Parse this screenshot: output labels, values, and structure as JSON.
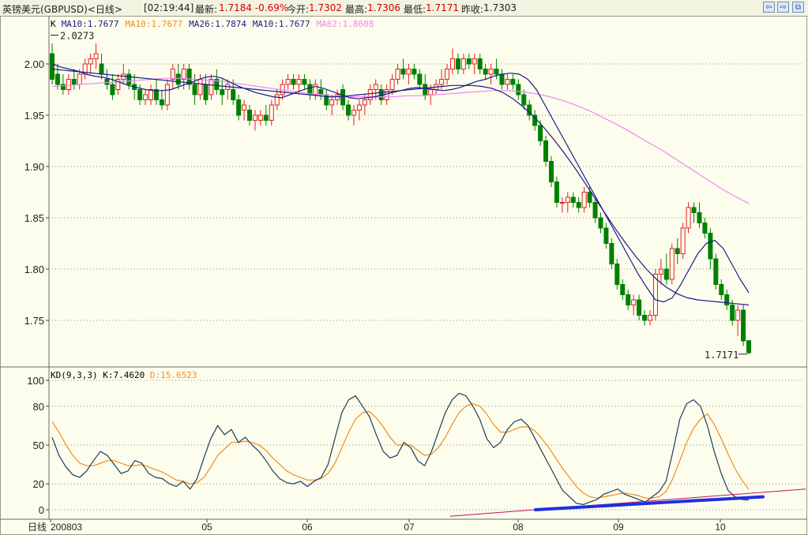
{
  "header": {
    "instrument": "英镑美元(GBPUSD)<日线>",
    "time": "[02:19:44]",
    "latest_label": "最新:",
    "latest": "1.7184 -0.69%",
    "open_label": "今开:",
    "open": "1.7302",
    "high_label": "最高:",
    "high": "1.7306",
    "low_label": "最低:",
    "low": "1.7171",
    "prev_close_label": "昨收:",
    "prev_close": "1.7303"
  },
  "colors": {
    "background": "#fdfded",
    "up_candle": "#e02020",
    "down_candle": "#008000",
    "ma10": "#1a1a8c",
    "ma26": "#1a1a8c",
    "ma62": "#ee88ee",
    "k_line": "#1c3d5c",
    "d_line": "#ef8c1c",
    "trend_line": "#1f2fe0",
    "trend_extension": "#c01060",
    "grid": "#8a8a8a"
  },
  "chart_data": [
    {
      "type": "candlestick",
      "legend": [
        {
          "text": "K",
          "color": "#000000"
        },
        {
          "text": "MA10:1.7677",
          "color": "#1a1a8c"
        },
        {
          "text": "MA10:1.7677",
          "color": "#ef8c1c"
        },
        {
          "text": "MA26:1.7874",
          "color": "#1a1a8c"
        },
        {
          "text": "MA10:1.7677",
          "color": "#1a1a8c"
        },
        {
          "text": "MA62:1.8608",
          "color": "#ee88ee"
        }
      ],
      "yticks": [
        2.0,
        1.95,
        1.9,
        1.85,
        1.8,
        1.75
      ],
      "ytick_labels": [
        "2.00",
        "1.95",
        "1.90",
        "1.85",
        "1.80",
        "1.75"
      ],
      "ylim": [
        1.7065,
        2.0455
      ],
      "grid": true,
      "max_label": "2.0273",
      "min_label": "1.7171",
      "candles_ohlc": [
        [
          2.01,
          2.02,
          1.98,
          1.985
        ],
        [
          1.99,
          2.0,
          1.975,
          1.98
        ],
        [
          1.98,
          1.99,
          1.97,
          1.975
        ],
        [
          1.975,
          1.99,
          1.97,
          1.985
        ],
        [
          1.985,
          1.995,
          1.975,
          1.98
        ],
        [
          1.98,
          1.995,
          1.975,
          1.99
        ],
        [
          1.99,
          2.005,
          1.985,
          2.0
        ],
        [
          2.0,
          2.01,
          1.99,
          2.005
        ],
        [
          2.005,
          2.02,
          1.995,
          2.01
        ],
        [
          2.0,
          2.01,
          1.985,
          1.99
        ],
        [
          1.985,
          1.995,
          1.975,
          1.98
        ],
        [
          1.98,
          1.99,
          1.965,
          1.97
        ],
        [
          1.975,
          1.99,
          1.97,
          1.985
        ],
        [
          1.985,
          2.0,
          1.98,
          1.99
        ],
        [
          1.99,
          1.995,
          1.975,
          1.98
        ],
        [
          1.98,
          1.99,
          1.965,
          1.975
        ],
        [
          1.975,
          1.98,
          1.96,
          1.965
        ],
        [
          1.965,
          1.975,
          1.96,
          1.97
        ],
        [
          1.965,
          1.98,
          1.96,
          1.975
        ],
        [
          1.975,
          1.985,
          1.96,
          1.965
        ],
        [
          1.965,
          1.975,
          1.955,
          1.96
        ],
        [
          1.96,
          1.985,
          1.955,
          1.98
        ],
        [
          1.985,
          2.0,
          1.975,
          1.995
        ],
        [
          1.99,
          2.0,
          1.975,
          1.98
        ],
        [
          1.985,
          2.0,
          1.975,
          1.995
        ],
        [
          1.995,
          2.0,
          1.975,
          1.98
        ],
        [
          1.98,
          1.99,
          1.96,
          1.97
        ],
        [
          1.97,
          1.99,
          1.965,
          1.985
        ],
        [
          1.98,
          1.99,
          1.96,
          1.965
        ],
        [
          1.97,
          1.99,
          1.965,
          1.985
        ],
        [
          1.985,
          1.995,
          1.97,
          1.975
        ],
        [
          1.975,
          1.985,
          1.96,
          1.97
        ],
        [
          1.975,
          1.985,
          1.965,
          1.98
        ],
        [
          1.975,
          1.985,
          1.96,
          1.965
        ],
        [
          1.965,
          1.97,
          1.945,
          1.95
        ],
        [
          1.955,
          1.965,
          1.945,
          1.96
        ],
        [
          1.955,
          1.96,
          1.94,
          1.945
        ],
        [
          1.945,
          1.955,
          1.935,
          1.95
        ],
        [
          1.945,
          1.955,
          1.94,
          1.95
        ],
        [
          1.95,
          1.96,
          1.94,
          1.945
        ],
        [
          1.945,
          1.965,
          1.94,
          1.96
        ],
        [
          1.96,
          1.975,
          1.955,
          1.97
        ],
        [
          1.97,
          1.985,
          1.965,
          1.98
        ],
        [
          1.98,
          1.99,
          1.975,
          1.985
        ],
        [
          1.985,
          1.99,
          1.975,
          1.98
        ],
        [
          1.98,
          1.99,
          1.97,
          1.985
        ],
        [
          1.985,
          1.99,
          1.975,
          1.98
        ],
        [
          1.98,
          1.985,
          1.965,
          1.97
        ],
        [
          1.97,
          1.985,
          1.965,
          1.98
        ],
        [
          1.975,
          1.985,
          1.965,
          1.97
        ],
        [
          1.97,
          1.975,
          1.955,
          1.96
        ],
        [
          1.96,
          1.97,
          1.95,
          1.965
        ],
        [
          1.965,
          1.975,
          1.96,
          1.97
        ],
        [
          1.975,
          1.98,
          1.955,
          1.96
        ],
        [
          1.96,
          1.965,
          1.945,
          1.95
        ],
        [
          1.95,
          1.96,
          1.94,
          1.955
        ],
        [
          1.955,
          1.965,
          1.945,
          1.96
        ],
        [
          1.96,
          1.97,
          1.95,
          1.965
        ],
        [
          1.965,
          1.98,
          1.96,
          1.975
        ],
        [
          1.975,
          1.985,
          1.965,
          1.98
        ],
        [
          1.975,
          1.98,
          1.96,
          1.965
        ],
        [
          1.965,
          1.98,
          1.96,
          1.975
        ],
        [
          1.975,
          1.99,
          1.97,
          1.985
        ],
        [
          1.985,
          2.0,
          1.98,
          1.995
        ],
        [
          1.995,
          2.005,
          1.985,
          1.99
        ],
        [
          1.99,
          2.0,
          1.98,
          1.995
        ],
        [
          1.995,
          2.0,
          1.985,
          1.99
        ],
        [
          1.99,
          1.995,
          1.975,
          1.98
        ],
        [
          1.98,
          1.99,
          1.965,
          1.97
        ],
        [
          1.97,
          1.98,
          1.96,
          1.975
        ],
        [
          1.975,
          1.985,
          1.97,
          1.98
        ],
        [
          1.98,
          1.995,
          1.975,
          1.985
        ],
        [
          1.985,
          2.0,
          1.98,
          1.995
        ],
        [
          1.995,
          2.015,
          1.99,
          2.005
        ],
        [
          2.005,
          2.01,
          1.99,
          1.995
        ],
        [
          1.995,
          2.01,
          1.99,
          2.005
        ],
        [
          2.005,
          2.01,
          1.995,
          2.0
        ],
        [
          2.0,
          2.01,
          1.99,
          2.005
        ],
        [
          2.005,
          2.01,
          1.99,
          1.995
        ],
        [
          1.995,
          2.0,
          1.985,
          1.99
        ],
        [
          1.99,
          2.0,
          1.98,
          1.995
        ],
        [
          1.995,
          2.005,
          1.985,
          1.99
        ],
        [
          1.99,
          1.995,
          1.975,
          1.98
        ],
        [
          1.98,
          1.99,
          1.975,
          1.985
        ],
        [
          1.985,
          1.99,
          1.975,
          1.98
        ],
        [
          1.98,
          1.985,
          1.965,
          1.97
        ],
        [
          1.97,
          1.975,
          1.955,
          1.96
        ],
        [
          1.96,
          1.965,
          1.945,
          1.95
        ],
        [
          1.95,
          1.955,
          1.935,
          1.94
        ],
        [
          1.94,
          1.945,
          1.92,
          1.925
        ],
        [
          1.925,
          1.93,
          1.9,
          1.905
        ],
        [
          1.905,
          1.91,
          1.88,
          1.885
        ],
        [
          1.885,
          1.89,
          1.86,
          1.865
        ],
        [
          1.865,
          1.87,
          1.855,
          1.865
        ],
        [
          1.865,
          1.875,
          1.855,
          1.87
        ],
        [
          1.87,
          1.875,
          1.86,
          1.865
        ],
        [
          1.865,
          1.87,
          1.855,
          1.86
        ],
        [
          1.86,
          1.88,
          1.855,
          1.875
        ],
        [
          1.875,
          1.88,
          1.86,
          1.865
        ],
        [
          1.865,
          1.87,
          1.845,
          1.85
        ],
        [
          1.85,
          1.855,
          1.835,
          1.84
        ],
        [
          1.84,
          1.845,
          1.82,
          1.825
        ],
        [
          1.825,
          1.83,
          1.8,
          1.805
        ],
        [
          1.805,
          1.81,
          1.78,
          1.785
        ],
        [
          1.785,
          1.79,
          1.77,
          1.775
        ],
        [
          1.775,
          1.78,
          1.76,
          1.765
        ],
        [
          1.765,
          1.775,
          1.755,
          1.77
        ],
        [
          1.77,
          1.775,
          1.75,
          1.755
        ],
        [
          1.755,
          1.76,
          1.745,
          1.75
        ],
        [
          1.75,
          1.76,
          1.745,
          1.755
        ],
        [
          1.755,
          1.8,
          1.75,
          1.795
        ],
        [
          1.795,
          1.81,
          1.785,
          1.8
        ],
        [
          1.8,
          1.815,
          1.785,
          1.79
        ],
        [
          1.79,
          1.825,
          1.785,
          1.82
        ],
        [
          1.82,
          1.83,
          1.805,
          1.815
        ],
        [
          1.815,
          1.845,
          1.81,
          1.84
        ],
        [
          1.84,
          1.865,
          1.835,
          1.86
        ],
        [
          1.86,
          1.865,
          1.845,
          1.855
        ],
        [
          1.855,
          1.865,
          1.84,
          1.845
        ],
        [
          1.845,
          1.85,
          1.83,
          1.835
        ],
        [
          1.835,
          1.84,
          1.8,
          1.81
        ],
        [
          1.81,
          1.815,
          1.78,
          1.785
        ],
        [
          1.785,
          1.79,
          1.77,
          1.775
        ],
        [
          1.775,
          1.78,
          1.76,
          1.765
        ],
        [
          1.765,
          1.77,
          1.745,
          1.75
        ],
        [
          1.75,
          1.765,
          1.735,
          1.76
        ],
        [
          1.76,
          1.765,
          1.725,
          1.73
        ],
        [
          1.7302,
          1.7306,
          1.7171,
          1.7184
        ]
      ],
      "ma10": [
        2.0,
        1.997,
        1.995,
        1.993,
        1.99,
        1.988,
        1.987,
        1.985,
        1.982,
        1.979,
        1.977,
        1.975,
        1.974,
        1.974,
        1.975,
        1.978,
        1.981,
        1.984,
        1.987,
        1.988,
        1.986,
        1.982,
        1.978,
        1.975,
        1.972,
        1.97,
        1.968,
        1.967,
        1.97,
        1.973,
        1.976,
        1.978,
        1.976,
        1.973,
        1.97,
        1.967,
        1.966,
        1.967,
        1.968,
        1.97,
        1.972,
        1.974,
        1.976,
        1.977,
        1.976,
        1.975,
        1.974,
        1.975,
        1.977,
        1.98,
        1.983,
        1.985,
        1.988,
        1.99,
        1.991,
        1.99,
        1.985,
        1.975,
        1.96,
        1.945,
        1.93,
        1.915,
        1.9,
        1.885,
        1.87,
        1.855,
        1.84,
        1.825,
        1.81,
        1.795,
        1.782,
        1.77,
        1.768,
        1.772,
        1.785,
        1.8,
        1.815,
        1.825,
        1.828,
        1.82,
        1.805,
        1.79,
        1.777
      ],
      "ma26": [
        1.995,
        1.994,
        1.993,
        1.992,
        1.991,
        1.99,
        1.989,
        1.988,
        1.987,
        1.986,
        1.985,
        1.984,
        1.983,
        1.982,
        1.981,
        1.98,
        1.979,
        1.978,
        1.977,
        1.976,
        1.975,
        1.974,
        1.973,
        1.972,
        1.971,
        1.97,
        1.969,
        1.968,
        1.968,
        1.969,
        1.97,
        1.971,
        1.972,
        1.973,
        1.974,
        1.975,
        1.976,
        1.977,
        1.978,
        1.979,
        1.979,
        1.979,
        1.978,
        1.976,
        1.972,
        1.966,
        1.958,
        1.949,
        1.938,
        1.926,
        1.913,
        1.899,
        1.884,
        1.869,
        1.854,
        1.839,
        1.825,
        1.812,
        1.8,
        1.79,
        1.782,
        1.776,
        1.772,
        1.77,
        1.769,
        1.768,
        1.767,
        1.766,
        1.765
      ],
      "ma62": [
        1.978,
        1.979,
        1.98,
        1.981,
        1.982,
        1.983,
        1.984,
        1.985,
        1.986,
        1.986,
        1.985,
        1.984,
        1.983,
        1.981,
        1.979,
        1.977,
        1.975,
        1.973,
        1.971,
        1.97,
        1.969,
        1.968,
        1.968,
        1.968,
        1.968,
        1.969,
        1.969,
        1.97,
        1.971,
        1.972,
        1.973,
        1.974,
        1.974,
        1.973,
        1.971,
        1.968,
        1.964,
        1.959,
        1.953,
        1.946,
        1.939,
        1.931,
        1.923,
        1.915,
        1.906,
        1.897,
        1.888,
        1.879,
        1.871,
        1.864
      ],
      "annotations": [
        "2.0273",
        "1.7171"
      ]
    },
    {
      "type": "line",
      "indicator": "KD(9,3,3)",
      "legend": [
        {
          "text": "KD(9,3,3)",
          "color": "#000000"
        },
        {
          "text": "K:7.4620",
          "color": "#000000"
        },
        {
          "text": "D:15.6523",
          "color": "#ef8c1c"
        }
      ],
      "yticks": [
        100,
        80,
        50,
        20,
        0
      ],
      "ytick_labels": [
        "100",
        "80",
        "50",
        "20",
        "0"
      ],
      "ylim": [
        -4,
        102
      ],
      "grid": true,
      "k_values": [
        56,
        42,
        33,
        27,
        25,
        30,
        38,
        45,
        42,
        35,
        28,
        30,
        38,
        36,
        28,
        25,
        24,
        20,
        18,
        22,
        16,
        24,
        40,
        55,
        65,
        58,
        62,
        52,
        56,
        50,
        45,
        38,
        30,
        24,
        21,
        20,
        22,
        18,
        22,
        25,
        35,
        55,
        75,
        85,
        88,
        80,
        72,
        58,
        45,
        40,
        42,
        52,
        48,
        38,
        34,
        45,
        60,
        75,
        85,
        90,
        88,
        80,
        70,
        55,
        48,
        52,
        62,
        68,
        70,
        65,
        55,
        45,
        35,
        25,
        15,
        10,
        5,
        4,
        6,
        8,
        12,
        14,
        16,
        12,
        10,
        8,
        6,
        10,
        14,
        22,
        45,
        70,
        82,
        85,
        80,
        65,
        45,
        28,
        15,
        10,
        8,
        7.462
      ],
      "d_values": [
        68,
        60,
        50,
        42,
        36,
        34,
        34,
        36,
        38,
        38,
        36,
        34,
        34,
        35,
        33,
        31,
        29,
        26,
        23,
        22,
        20,
        21,
        25,
        33,
        42,
        47,
        52,
        52,
        53,
        52,
        50,
        46,
        40,
        35,
        30,
        27,
        25,
        23,
        23,
        24,
        28,
        36,
        48,
        60,
        70,
        75,
        76,
        71,
        64,
        56,
        50,
        50,
        50,
        46,
        42,
        43,
        48,
        56,
        66,
        75,
        80,
        82,
        80,
        74,
        66,
        60,
        60,
        62,
        64,
        64,
        61,
        55,
        48,
        40,
        32,
        25,
        18,
        13,
        10,
        9,
        10,
        11,
        12,
        13,
        12,
        11,
        9,
        9,
        10,
        14,
        24,
        38,
        52,
        63,
        70,
        74,
        66,
        55,
        43,
        32,
        23,
        15.6523
      ],
      "trend_label": ""
    }
  ],
  "x_axis": {
    "tick_labels": [
      "200803",
      "05",
      "06",
      "07",
      "08",
      "09",
      "10"
    ],
    "period_label": "日线"
  }
}
